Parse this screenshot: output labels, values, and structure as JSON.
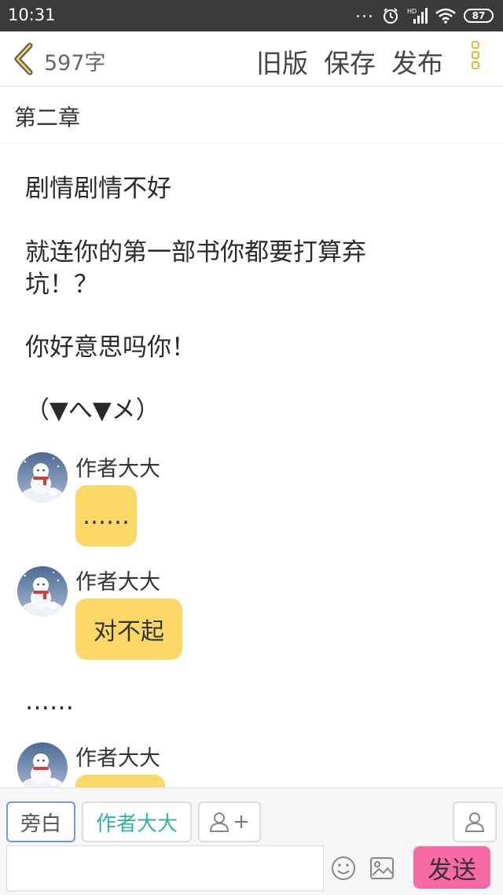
{
  "status_bar": {
    "time": "10:31",
    "dots": "...",
    "battery": "87",
    "hd": "HD"
  },
  "nav": {
    "word_count": "597字",
    "old_version": "旧版",
    "save": "保存",
    "publish": "发布"
  },
  "chapter_title": "第二章",
  "content": {
    "paragraphs": [
      "剧情剧情不好",
      "就连你的第一部书你都要打算弃",
      "坑！？",
      "你好意思吗你！",
      "（▼へ▼メ）"
    ],
    "messages": [
      {
        "name": "作者大大",
        "text": "……"
      },
      {
        "name": "作者大大",
        "text": "对不起"
      }
    ],
    "narration_after": "……",
    "partial_message": {
      "name": "作者大大"
    }
  },
  "bottom_bar": {
    "narration_label": "旁白",
    "author_label": "作者大大",
    "add_role": "+",
    "send_label": "发送",
    "input_value": ""
  },
  "colors": {
    "bubble": "#fbd865",
    "send": "#f76aa4",
    "author_role": "#2db7a0",
    "accent_more": "#e2b93a"
  },
  "icons": [
    "back-chevron-icon",
    "more-menu-icon",
    "add-person-icon",
    "person-icon",
    "emoji-icon",
    "image-icon",
    "alarm-icon",
    "signal-icon",
    "wifi-icon",
    "battery-icon"
  ]
}
